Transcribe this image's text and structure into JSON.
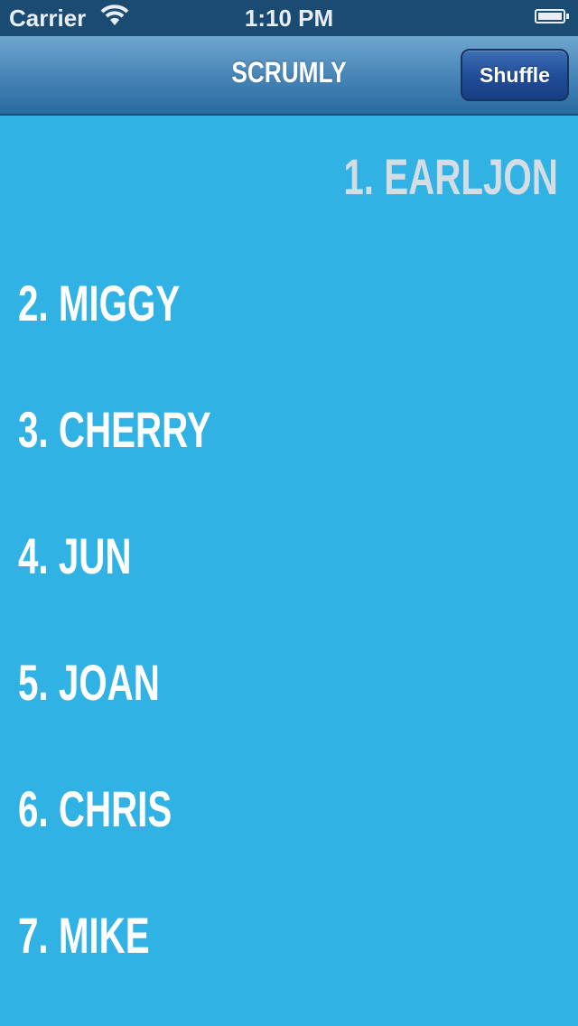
{
  "status_bar": {
    "carrier": "Carrier",
    "time": "1:10 PM"
  },
  "nav_bar": {
    "title": "SCRUMLY",
    "shuffle_label": "Shuffle"
  },
  "list": {
    "items": [
      {
        "label": "1. EARLJON"
      },
      {
        "label": "2. MIGGY"
      },
      {
        "label": "3. CHERRY"
      },
      {
        "label": "4. JUN"
      },
      {
        "label": "5. JOAN"
      },
      {
        "label": "6. CHRIS"
      },
      {
        "label": "7. MIKE"
      }
    ]
  },
  "colors": {
    "background": "#30b2e5",
    "active_item": "#d3dde3",
    "item_text": "#ffffff",
    "nav_bar": "#4886b8",
    "shuffle_button": "#214e99"
  }
}
